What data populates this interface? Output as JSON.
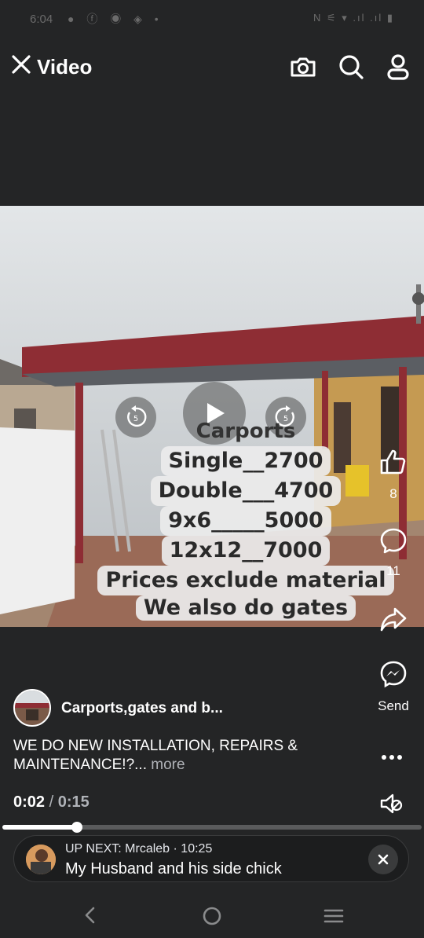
{
  "status_bar": {
    "time": "6:04",
    "notification_icons": "● ⓕ ◉ ◈ •",
    "right_icons": "N ⚟ ▾ .ıl .ıl ▮"
  },
  "header": {
    "title": "Video",
    "icons": [
      "close-icon",
      "camera-icon",
      "search-icon",
      "profile-icon"
    ]
  },
  "video": {
    "overlay": {
      "title": "Carports",
      "lines": [
        "Single__2700",
        "Double___4700",
        "9x6_____5000",
        "12x12__7000",
        "Prices exclude material",
        "We also do gates"
      ]
    },
    "rewind_label": "5",
    "forward_label": "5"
  },
  "rail": {
    "like_count": "8",
    "comment_count": "11",
    "send_label": "Send"
  },
  "post": {
    "author": "Carports,gates and b...",
    "caption_line1": "WE DO NEW INSTALLATION, REPAIRS &",
    "caption_line2": "MAINTENANCE!?...",
    "more_label": "more"
  },
  "player": {
    "current_time": "0:02",
    "separator": "/",
    "duration": "0:15",
    "progress": 0.177
  },
  "up_next": {
    "prefix": "UP NEXT: Mrcaleb · 10:25",
    "title": "My Husband and his side chick"
  },
  "colors": {
    "background": "#242526",
    "accent_text": "#ffffff",
    "secondary_text": "#b0b3b8",
    "roof": "#8e2d34"
  }
}
